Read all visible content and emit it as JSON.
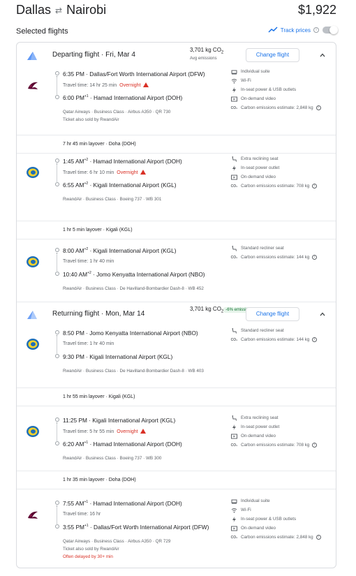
{
  "header": {
    "origin": "Dallas",
    "destination": "Nairobi",
    "total_price": "$1,922"
  },
  "selected": {
    "label": "Selected flights",
    "track_prices": "Track prices"
  },
  "departing": {
    "title": "Departing flight",
    "date": "Fri, Mar 4",
    "co2": "3,701 kg CO",
    "co2_sub": "2",
    "co2_note": "Avg emissions",
    "change_label": "Change flight",
    "segments": [
      {
        "airline": "qatar",
        "dep_time": "6:35 PM",
        "dep_sup": "",
        "dep_airport": "Dallas/Fort Worth International Airport (DFW)",
        "travel": "Travel time: 14 hr 25 min",
        "overnight": "Overnight",
        "arr_time": "6:00 PM",
        "arr_sup": "+1",
        "arr_airport": "Hamad International Airport (DOH)",
        "meta": "Qatar Airways · Business Class · Airbus A350 · QR 730",
        "meta2": "Ticket also sold by RwandAir",
        "amenities": [
          "Individual suite",
          "Wi-Fi",
          "In-seat power & USB outlets",
          "On-demand video"
        ],
        "carbon": "Carbon emissions estimate: 2,848 kg"
      },
      {
        "airline": "rwandair",
        "dep_time": "1:45 AM",
        "dep_sup": "+2",
        "dep_airport": "Hamad International Airport (DOH)",
        "travel": "Travel time: 6 hr 10 min",
        "overnight": "Overnight",
        "arr_time": "6:55 AM",
        "arr_sup": "+2",
        "arr_airport": "Kigali International Airport (KGL)",
        "meta": "RwandAir · Business Class · Boeing 737 · WB 301",
        "amenities": [
          "Extra reclining seat",
          "In-seat power outlet",
          "On-demand video"
        ],
        "carbon": "Carbon emissions estimate: 708 kg"
      },
      {
        "airline": "rwandair",
        "dep_time": "8:00 AM",
        "dep_sup": "+2",
        "dep_airport": "Kigali International Airport (KGL)",
        "travel": "Travel time: 1 hr 40 min",
        "overnight": "",
        "arr_time": "10:40 AM",
        "arr_sup": "+2",
        "arr_airport": "Jomo Kenyatta International Airport (NBO)",
        "meta": "RwandAir · Business Class · De Havilland-Bombardier Dash-8 · WB 452",
        "amenities": [
          "Standard recliner seat"
        ],
        "carbon": "Carbon emissions estimate: 144 kg"
      }
    ],
    "layovers": [
      "7 hr 45 min layover · Doha (DOH)",
      "1 hr 5 min layover · Kigali (KGL)"
    ]
  },
  "returning": {
    "title": "Returning flight",
    "date": "Mon, Mar 14",
    "co2": "3,701 kg CO",
    "co2_sub": "2",
    "co2_note": "-6% emissions",
    "change_label": "Change flight",
    "segments": [
      {
        "airline": "rwandair",
        "dep_time": "8:50 PM",
        "dep_sup": "",
        "dep_airport": "Jomo Kenyatta International Airport (NBO)",
        "travel": "Travel time: 1 hr 40 min",
        "overnight": "",
        "arr_time": "9:30 PM",
        "arr_sup": "",
        "arr_airport": "Kigali International Airport (KGL)",
        "meta": "RwandAir · Business Class · De Havilland-Bombardier Dash-8 · WB 403",
        "amenities": [
          "Standard recliner seat"
        ],
        "carbon": "Carbon emissions estimate: 144 kg"
      },
      {
        "airline": "rwandair",
        "dep_time": "11:25 PM",
        "dep_sup": "",
        "dep_airport": "Kigali International Airport (KGL)",
        "travel": "Travel time: 5 hr 55 min",
        "overnight": "Overnight",
        "arr_time": "6:20 AM",
        "arr_sup": "+1",
        "arr_airport": "Hamad International Airport (DOH)",
        "meta": "RwandAir · Business Class · Boeing 737 · WB 300",
        "amenities": [
          "Extra reclining seat",
          "In-seat power outlet",
          "On-demand video"
        ],
        "carbon": "Carbon emissions estimate: 708 kg"
      },
      {
        "airline": "qatar",
        "dep_time": "7:55 AM",
        "dep_sup": "+1",
        "dep_airport": "Hamad International Airport (DOH)",
        "travel": "Travel time: 16 hr",
        "overnight": "",
        "arr_time": "3:55 PM",
        "arr_sup": "+1",
        "arr_airport": "Dallas/Fort Worth International Airport (DFW)",
        "meta": "Qatar Airways · Business Class · Airbus A350 · QR 729",
        "meta2": "Ticket also sold by RwandAir",
        "meta3": "Often delayed by 30+ min",
        "amenities": [
          "Individual suite",
          "Wi-Fi",
          "In-seat power & USB outlets",
          "On-demand video"
        ],
        "carbon": "Carbon emissions estimate: 2,848 kg"
      }
    ],
    "layovers": [
      "1 hr 55 min layover · Kigali (KGL)",
      "1 hr 35 min layover · Doha (DOH)"
    ]
  },
  "colors": {
    "accent": "#1a73e8",
    "warning": "#d93025",
    "eco": "#137333"
  }
}
